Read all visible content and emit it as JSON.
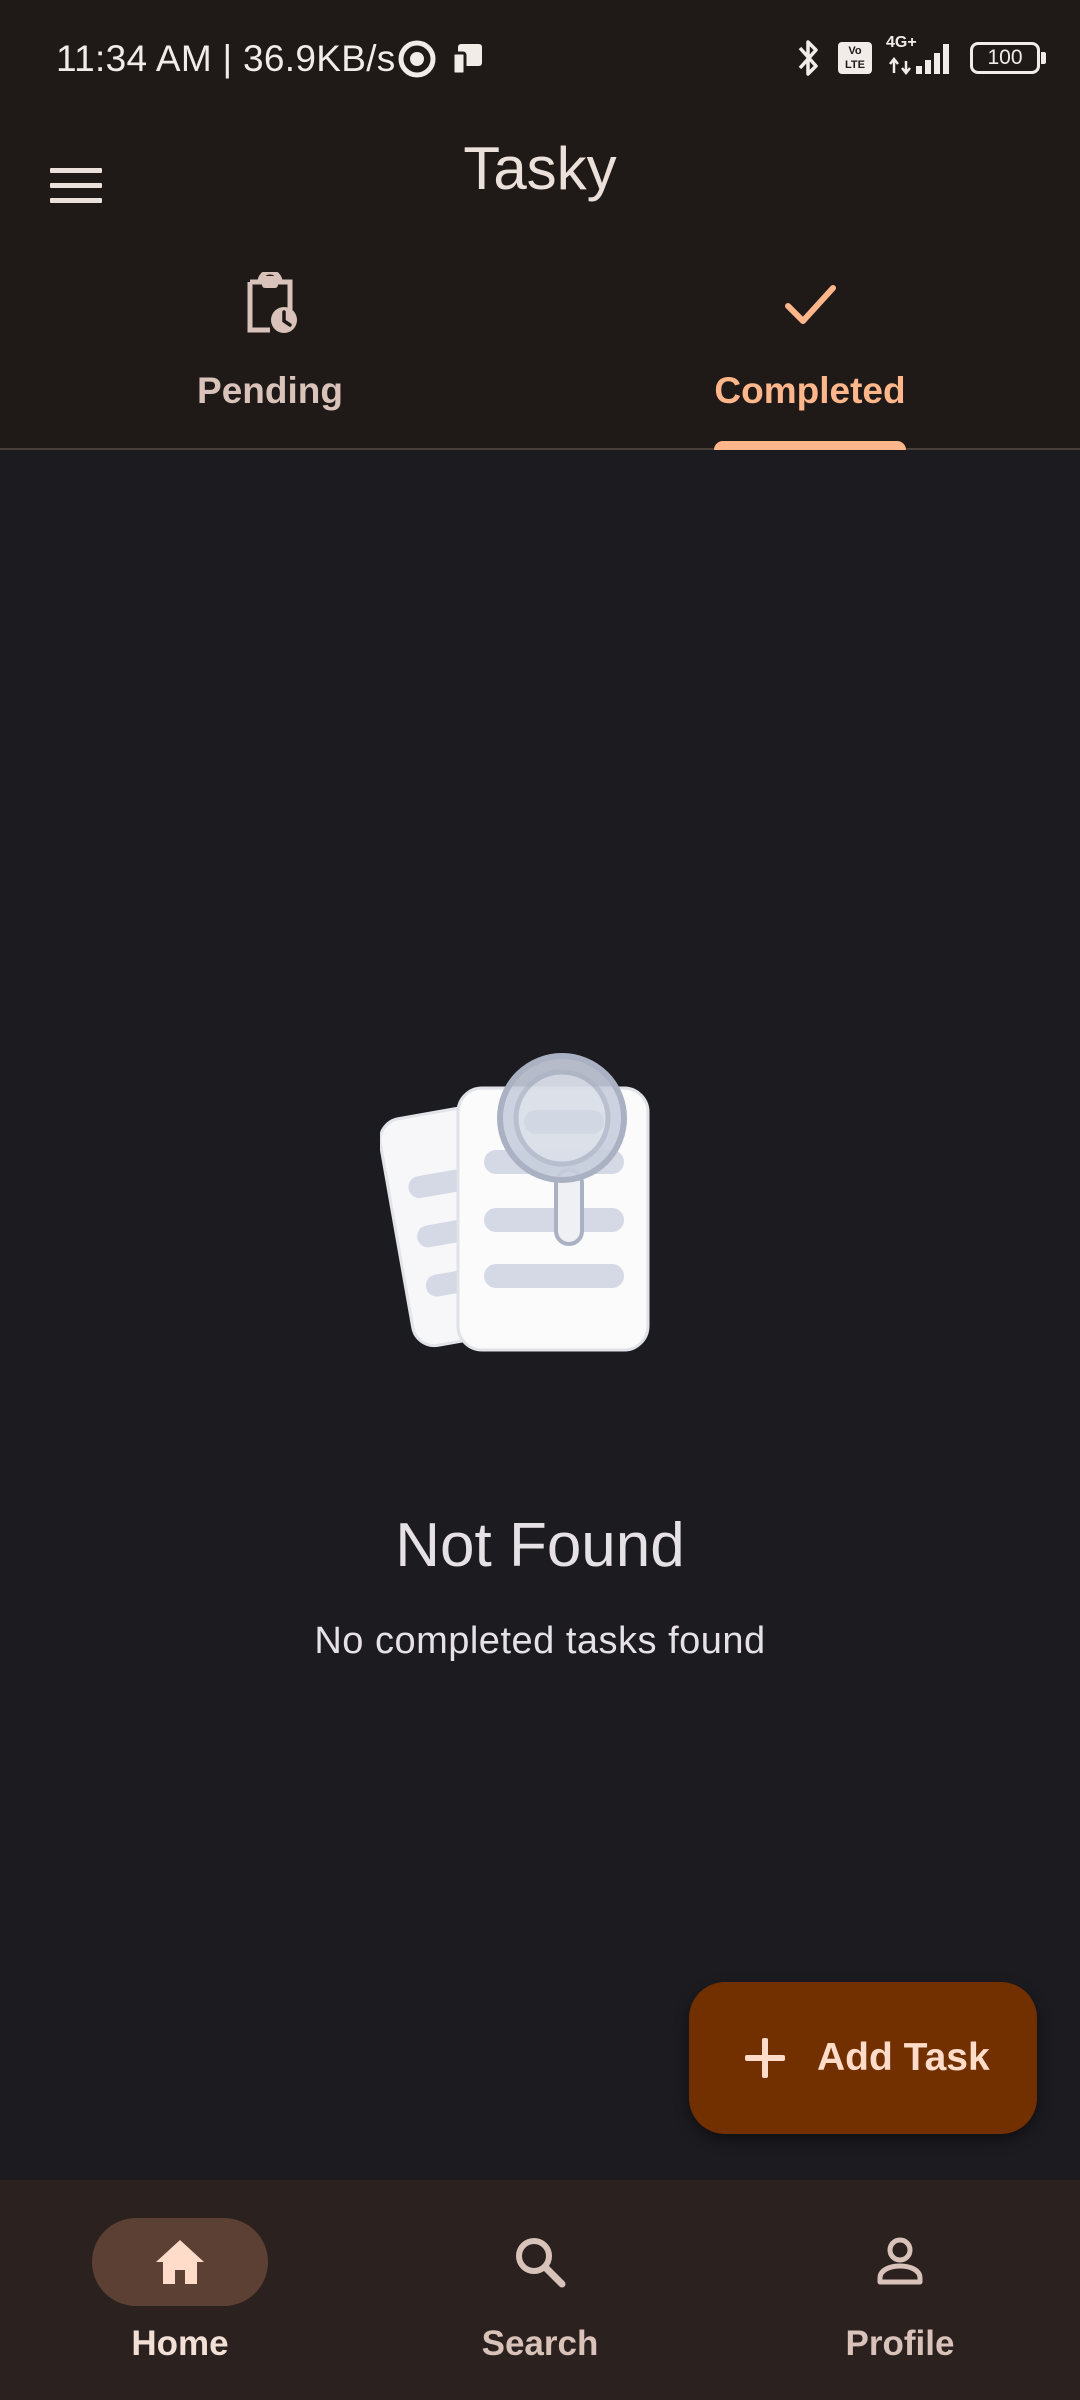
{
  "status_bar": {
    "time": "11:34 AM | 36.9KB/s",
    "network": "4G+",
    "volte": "Vo LTE",
    "battery": "100"
  },
  "app_bar": {
    "title": "Tasky",
    "menu_icon": "hamburger-menu-icon"
  },
  "tabs": [
    {
      "label": "Pending",
      "icon": "clipboard-clock-icon",
      "selected": false
    },
    {
      "label": "Completed",
      "icon": "check-icon",
      "selected": true
    }
  ],
  "empty_state": {
    "title": "Not Found",
    "message": "No completed tasks found",
    "illustration": "documents-magnifier-icon"
  },
  "fab": {
    "label": "Add Task",
    "icon": "plus-icon"
  },
  "bottom_nav": [
    {
      "label": "Home",
      "icon": "home-icon",
      "selected": true
    },
    {
      "label": "Search",
      "icon": "search-icon",
      "selected": false
    },
    {
      "label": "Profile",
      "icon": "person-icon",
      "selected": false
    }
  ],
  "colors": {
    "accent": "#ffb68a",
    "fab_background": "#723000",
    "fab_foreground": "#ffdbc9",
    "background": "#1c1b20",
    "surface": "#1f1a17",
    "nav_background": "#2b2220",
    "nav_indicator": "#5c4033"
  }
}
